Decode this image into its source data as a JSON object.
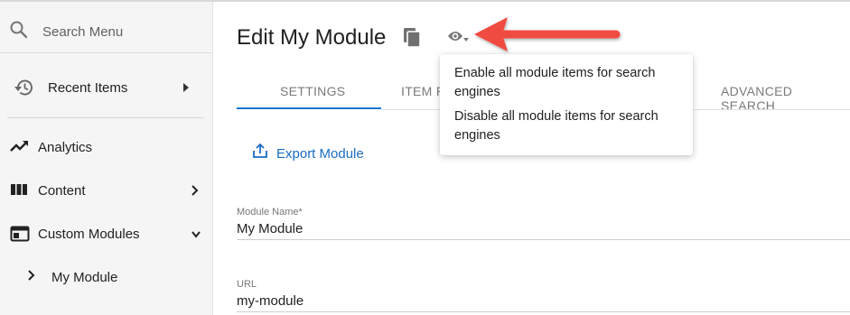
{
  "sidebar": {
    "search_placeholder": "Search Menu",
    "recent_items": "Recent Items",
    "items": [
      {
        "label": "Analytics",
        "icon": "trending-up-icon"
      },
      {
        "label": "Content",
        "icon": "columns-icon"
      },
      {
        "label": "Custom Modules",
        "icon": "web-module-icon"
      },
      {
        "label": "My Module",
        "icon": "chevron-right-icon"
      }
    ]
  },
  "main": {
    "title": "Edit My Module",
    "tabs": [
      {
        "label": "SETTINGS"
      },
      {
        "label": "ITEM PAGE"
      },
      {
        "label": "ADVANCED SEARCH"
      }
    ],
    "export_label": "Export Module",
    "fields": [
      {
        "label": "Module Name*",
        "value": "My Module"
      },
      {
        "label": "URL",
        "value": "my-module"
      }
    ]
  },
  "menu": {
    "items": [
      {
        "label": "Enable all module items for search engines"
      },
      {
        "label": "Disable all module items for search engines"
      }
    ]
  },
  "colors": {
    "accent": "#1976d2",
    "annotation_arrow": "#f04b3f",
    "sidebar_bg": "#f5f5f5"
  }
}
